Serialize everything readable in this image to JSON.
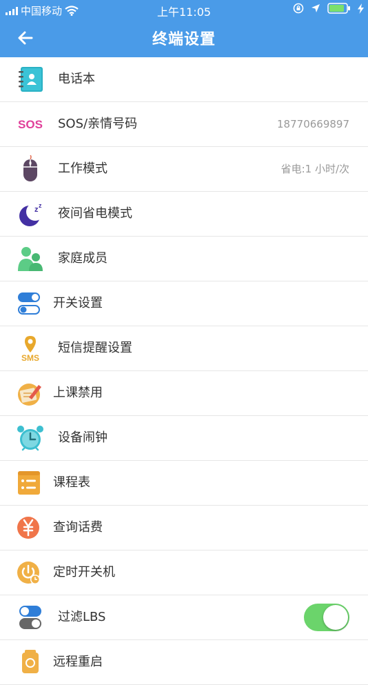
{
  "status_bar": {
    "carrier": "中国移动",
    "time": "上午11:05"
  },
  "header": {
    "title": "终端设置"
  },
  "sos_icon_text": "SOS",
  "sms_icon_text": "SMS",
  "items": [
    {
      "label": "电话本",
      "value": ""
    },
    {
      "label": "SOS/亲情号码",
      "value": "18770669897"
    },
    {
      "label": "工作模式",
      "value": "省电:1 小时/次"
    },
    {
      "label": "夜间省电模式",
      "value": ""
    },
    {
      "label": "家庭成员",
      "value": ""
    },
    {
      "label": "开关设置",
      "value": ""
    },
    {
      "label": "短信提醒设置",
      "value": ""
    },
    {
      "label": "上课禁用",
      "value": ""
    },
    {
      "label": "设备闹钟",
      "value": ""
    },
    {
      "label": "课程表",
      "value": ""
    },
    {
      "label": "查询话费",
      "value": ""
    },
    {
      "label": "定时开关机",
      "value": ""
    },
    {
      "label": "过滤LBS",
      "value": "",
      "toggle_on": true
    },
    {
      "label": "远程重启",
      "value": ""
    }
  ],
  "colors": {
    "header": "#4a9be8",
    "toggle_on": "#6bd46b",
    "sos": "#e0409a"
  }
}
